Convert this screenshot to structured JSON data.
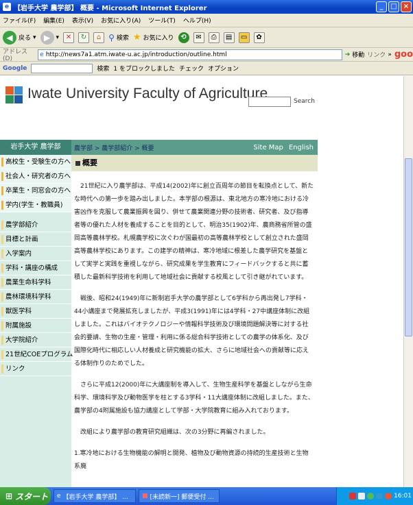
{
  "window": {
    "title": "【岩手大学 農学部】 概要 - Microsoft Internet Explorer"
  },
  "menu": [
    "ファイル(F)",
    "編集(E)",
    "表示(V)",
    "お気に入り(A)",
    "ツール(T)",
    "ヘルプ(H)"
  ],
  "toolbar": {
    "back": "戻る",
    "search": "検索",
    "favorites": "お気に入り"
  },
  "address": {
    "label": "アドレス(D)",
    "url": "http://news7a1.atm.iwate-u.ac.jp/introduction/outline.html",
    "go": "移動",
    "links": "リンク",
    "logo": "goo"
  },
  "googlebar": {
    "brand": "Google",
    "search": "検索",
    "blocked": "1 をブロックしました",
    "check": "チェック",
    "options": "オプション"
  },
  "site": {
    "title": "Iwate University Faculty of Agriculture",
    "search_label": "Search"
  },
  "nav": {
    "left": "岩手大学 農学部",
    "crumb": "農学部 > 農学部紹介 > 概要",
    "sitemap": "Site Map",
    "english": "English"
  },
  "sidebar1": [
    "高校生・受験生の方へ",
    "社会人・研究者の方へ",
    "卒業生・同窓会の方へ",
    "学内(学生・教職員)"
  ],
  "sidebar2": [
    "農学部紹介",
    "目標と計画",
    "入学案内",
    "学科・講座の構成",
    "農業生命科学科",
    "農林環境科学科",
    "獣医学科",
    "附属施設",
    "大学院紹介",
    "21世紀COEプログラム",
    "リンク"
  ],
  "heading": "概要",
  "paragraphs": [
    "21世紀に入り農学部は、平成14(2002)年に創立百周年の節目を転換点として、新たな時代への第一歩を踏み出しました。本学部の根源は、東北地方の寒冷地における冷害凶作を克服して農業振興を図り、併せて農業関連分野の技術者、研究者、及び指導者等の優れた人材を養成することを目的として、明治35(1902)年、農商務省所管の盛岡高等農林学校。札幌農学校に次ぐわが国最初の高等農林学校として創立された盛岡高等農林学校にあります。この建学の精神は、寒冷地域に根差した農学研究を基盤として実学と実践を重視しながら、研究成果を学生教育にフィードバックすると共に蓄積した最新科学技術を利用して地域社会に貢献する校風として引き継がれています。",
    "戦後、昭和24(1949)年に新制岩手大学の農学部として6学科から再出発し7学科・44小講座まで発展拡充しましたが、平成3(1991)年には4学科・27中講座体制に改組しました。これはバイオテクノロジーや情報科学技術及び環境問題解決等に対する社会的要請、生物の生産・管理・利用に係る総合科学技術としての農学の体系化、及び国際化時代に相応しい人材養成と研究機能の拡大、さらに地域社会への貢献等に応える体制作りのためでした。",
    "さらに平成12(2000)年に大講座制を導入して、生物生産科学を基盤としながら生命科学、環境科学及び動物医学を柱とする3学科・11大講座体制に改組しました。また、農学部の4附属施設も協力講座として学部・大学院教育に組み入れております。",
    "改組により農学部の教育研究組織は、次の3分野に再編されました。",
    "1.寒冷地における生物機能の解明と開発、植物及び動物資源の持続的生産技術と生物系廃"
  ],
  "taskbar": {
    "start": "スタート",
    "task1": "【岩手大学 農学部】 ...",
    "task2": "[未読新一] 郵便受付 ...",
    "clock": "16:01"
  },
  "colors": {
    "nav": "#5b9c8a",
    "sidebar": "#d8ede6",
    "heading_bg": "#e3e4c7",
    "title_bar": "#0a3fbf"
  }
}
